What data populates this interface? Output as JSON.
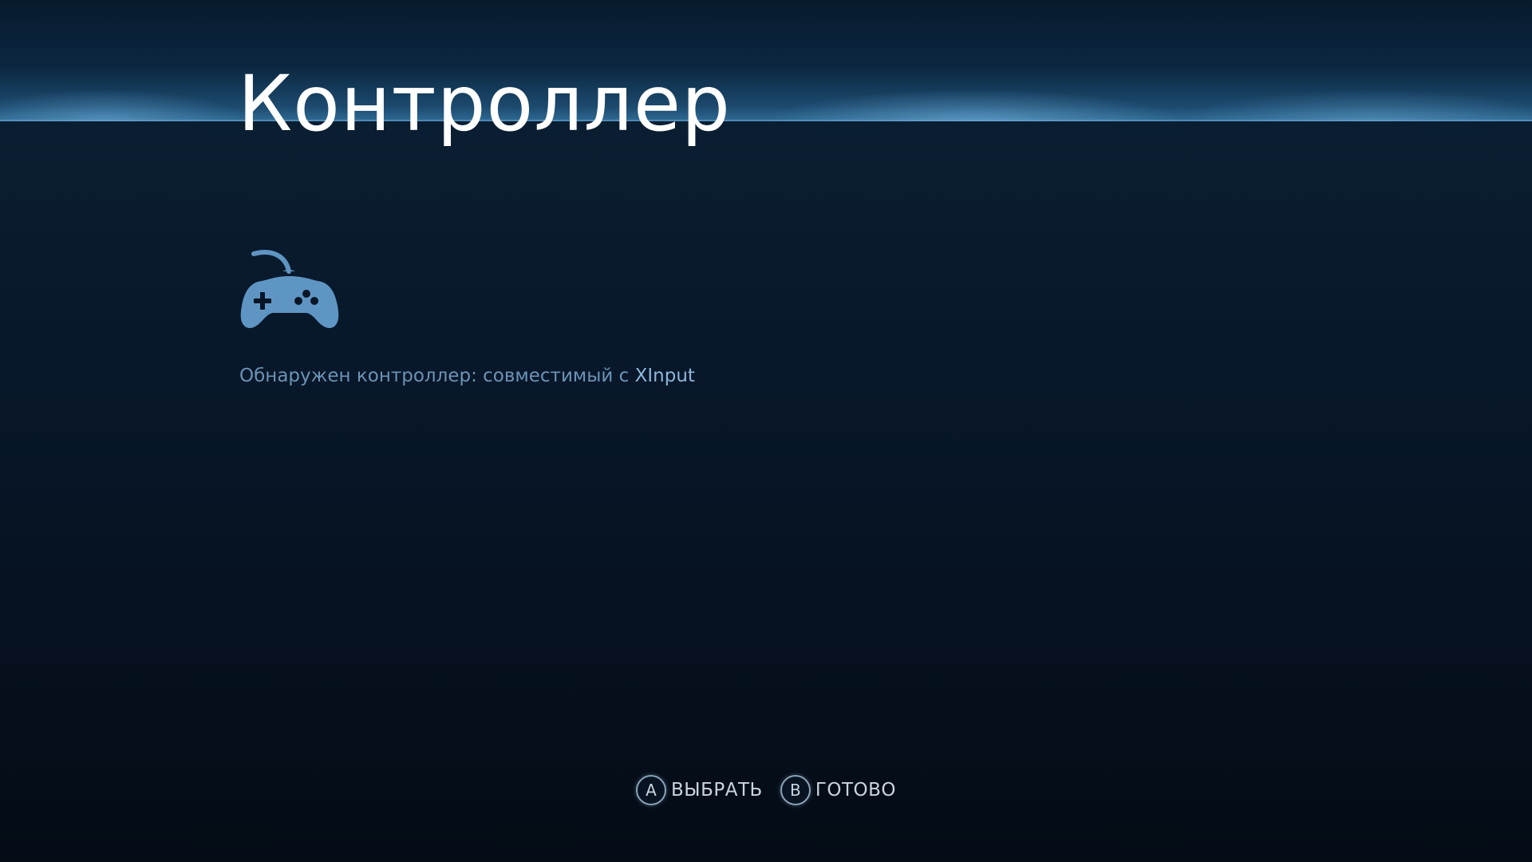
{
  "page": {
    "title": "Контроллер"
  },
  "status": {
    "prefix": "Обнаружен контроллер: совместимый с ",
    "value": "XInput"
  },
  "icons": {
    "controller": "gamepad-icon"
  },
  "footer": {
    "hints": [
      {
        "button": "A",
        "label": "ВЫБРАТЬ"
      },
      {
        "button": "B",
        "label": "ГОТОВО"
      }
    ]
  },
  "colors": {
    "accent": "#5f95c2",
    "status_text": "#6c93b6",
    "status_value": "#8cb6da",
    "title": "#ffffff"
  }
}
